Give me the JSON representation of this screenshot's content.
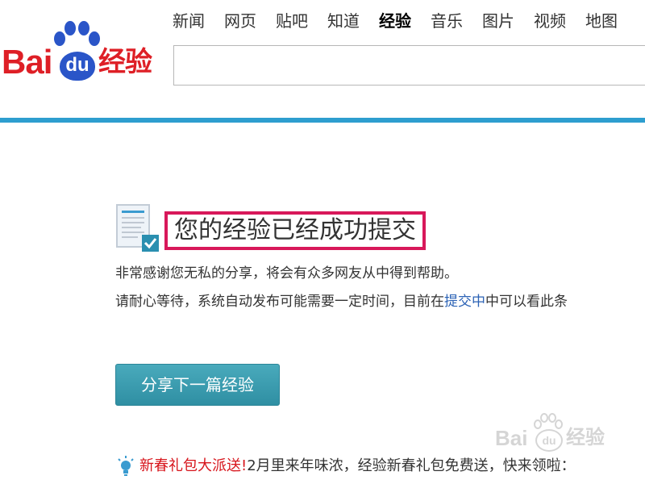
{
  "brand": {
    "logo_bai": "Bai",
    "logo_du": "du",
    "logo_suffix": "经验",
    "color": "#de1f26",
    "du_color": "#2a55c8"
  },
  "nav": {
    "items": [
      {
        "label": "新闻"
      },
      {
        "label": "网页"
      },
      {
        "label": "贴吧"
      },
      {
        "label": "知道"
      },
      {
        "label": "经验",
        "active": true
      },
      {
        "label": "音乐"
      },
      {
        "label": "图片"
      },
      {
        "label": "视频"
      },
      {
        "label": "地图"
      }
    ]
  },
  "search": {
    "value": ""
  },
  "header_bar_color": "#2e9ecf",
  "success": {
    "icon": "document-check-icon",
    "title": "您的经验已经成功提交",
    "highlight_color": "#d8185a"
  },
  "description": {
    "line1": "非常感谢您无私的分享，将会有众多网友从中得到帮助。",
    "line2_prefix": "请耐心等待，系统自动发布可能需要一定时间，目前在",
    "line2_link": "提交中",
    "line2_suffix": "中可以看此条"
  },
  "share_button": {
    "label": "分享下一篇经验",
    "color": "#3a9db0"
  },
  "promo": {
    "icon": "lightbulb-icon",
    "link": "新春礼包大派送",
    "separator": "!",
    "text": "2月里来年味浓，经验新春礼包免费送，快来领啦："
  },
  "watermark": {
    "bai": "Bai",
    "du": "du",
    "suffix": "经验"
  }
}
